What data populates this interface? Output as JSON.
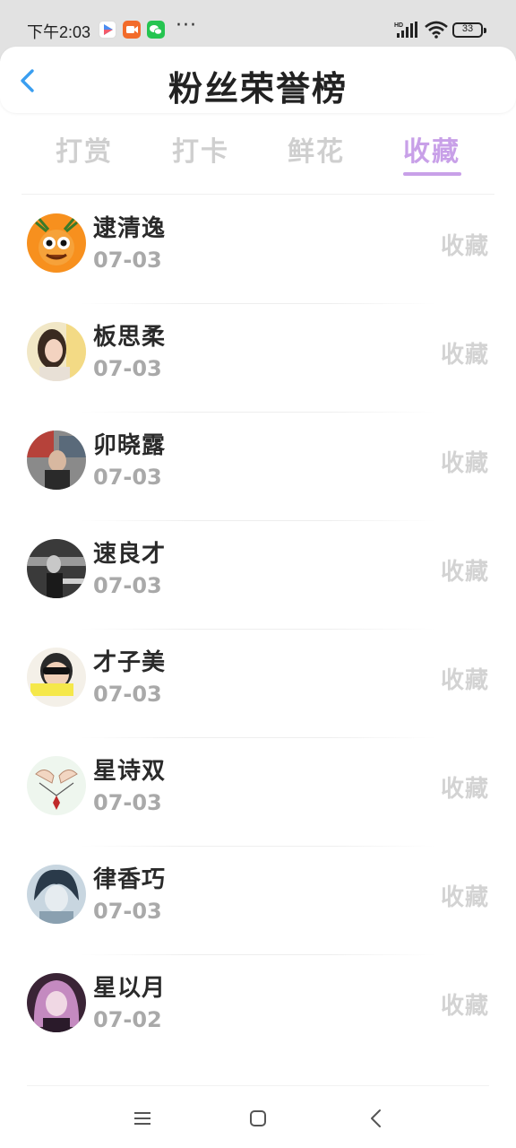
{
  "status_bar": {
    "time": "下午2:03",
    "more_dots": "···",
    "battery": "33",
    "hd_label": "HD"
  },
  "header": {
    "title": "粉丝荣誉榜",
    "accent_color": "#3a9ef0"
  },
  "tabs": [
    {
      "label": "打赏",
      "active": false
    },
    {
      "label": "打卡",
      "active": false
    },
    {
      "label": "鲜花",
      "active": false
    },
    {
      "label": "收藏",
      "active": true
    }
  ],
  "active_tab_color": "#c8a0e8",
  "fans": [
    {
      "name": "逮清逸",
      "date": "07-03",
      "tag": "收藏",
      "avatar_icon": "orange-cartoon-avatar-icon"
    },
    {
      "name": "板思柔",
      "date": "07-03",
      "tag": "收藏",
      "avatar_icon": "girl-photo-avatar-icon"
    },
    {
      "name": "卯晓露",
      "date": "07-03",
      "tag": "收藏",
      "avatar_icon": "street-photo-avatar-icon"
    },
    {
      "name": "速良才",
      "date": "07-03",
      "tag": "收藏",
      "avatar_icon": "bw-photo-avatar-icon"
    },
    {
      "name": "才子美",
      "date": "07-03",
      "tag": "收藏",
      "avatar_icon": "sunglasses-avatar-icon"
    },
    {
      "name": "星诗双",
      "date": "07-03",
      "tag": "收藏",
      "avatar_icon": "hands-necklace-avatar-icon"
    },
    {
      "name": "律香巧",
      "date": "07-03",
      "tag": "收藏",
      "avatar_icon": "anime-boy-avatar-icon"
    },
    {
      "name": "星以月",
      "date": "07-02",
      "tag": "收藏",
      "avatar_icon": "anime-girl-avatar-icon"
    }
  ]
}
